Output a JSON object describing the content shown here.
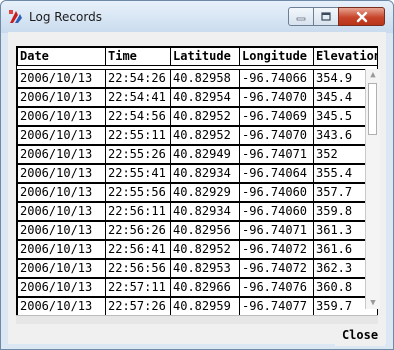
{
  "window": {
    "title": "Log Records"
  },
  "table": {
    "columns": [
      "Date",
      "Time",
      "Latitude",
      "Longitude",
      "Elevation"
    ],
    "rows": [
      [
        "2006/10/13",
        "22:54:26",
        "40.82958",
        "-96.74066",
        "354.9"
      ],
      [
        "2006/10/13",
        "22:54:41",
        "40.82954",
        "-96.74070",
        "345.4"
      ],
      [
        "2006/10/13",
        "22:54:56",
        "40.82952",
        "-96.74069",
        "345.5"
      ],
      [
        "2006/10/13",
        "22:55:11",
        "40.82952",
        "-96.74070",
        "343.6"
      ],
      [
        "2006/10/13",
        "22:55:26",
        "40.82949",
        "-96.74071",
        "352"
      ],
      [
        "2006/10/13",
        "22:55:41",
        "40.82934",
        "-96.74064",
        "355.4"
      ],
      [
        "2006/10/13",
        "22:55:56",
        "40.82929",
        "-96.74060",
        "357.7"
      ],
      [
        "2006/10/13",
        "22:56:11",
        "40.82934",
        "-96.74060",
        "359.8"
      ],
      [
        "2006/10/13",
        "22:56:26",
        "40.82956",
        "-96.74071",
        "361.3"
      ],
      [
        "2006/10/13",
        "22:56:41",
        "40.82952",
        "-96.74072",
        "361.6"
      ],
      [
        "2006/10/13",
        "22:56:56",
        "40.82953",
        "-96.74072",
        "362.3"
      ],
      [
        "2006/10/13",
        "22:57:11",
        "40.82966",
        "-96.74076",
        "360.8"
      ],
      [
        "2006/10/13",
        "22:57:26",
        "40.82959",
        "-96.74077",
        "359.7"
      ]
    ]
  },
  "actions": {
    "close_label": "Close"
  },
  "icons": {
    "app": "log-records-icon",
    "minimize": "minimize-icon",
    "maximize": "maximize-icon",
    "close": "close-icon",
    "scroll_up": "scroll-up-arrow-icon",
    "scroll_down": "scroll-down-arrow-icon"
  },
  "colors": {
    "close_button": "#c7452b",
    "titlebar": "#dbe8f4",
    "app_icon": "#c81e1e"
  }
}
